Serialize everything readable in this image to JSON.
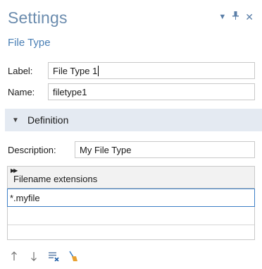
{
  "header": {
    "title": "Settings",
    "subtitle": "File Type"
  },
  "window_controls": [
    {
      "icon": "dropdown-arrow-icon",
      "glyph": "▾"
    },
    {
      "icon": "pin-icon",
      "glyph": "⊥"
    },
    {
      "icon": "close-icon",
      "glyph": "×"
    }
  ],
  "form": {
    "label": {
      "caption": "Label:",
      "value": "File Type 1"
    },
    "name": {
      "caption": "Name:",
      "value": "filetype1"
    }
  },
  "definition": {
    "section_title": "Definition",
    "description": {
      "caption": "Description:",
      "value": "My File Type"
    }
  },
  "extensions_table": {
    "column_header": "Filename extensions",
    "rows": [
      "*.myfile",
      "",
      ""
    ]
  },
  "toolbar": {
    "buttons": [
      "move-up-icon",
      "move-down-icon",
      "delete-rows-icon",
      "clear-table-icon"
    ]
  },
  "colors": {
    "title": "#6b8cae",
    "subtitle": "#4a7fb5",
    "section_bg": "#e4eaf2",
    "selection_border": "#3d7fc6"
  }
}
